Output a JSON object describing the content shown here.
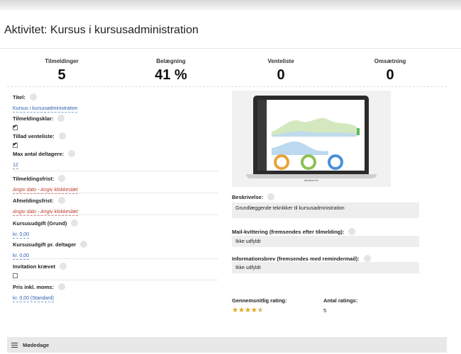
{
  "page": {
    "title": "Aktivitet: Kursus i kursusadministration"
  },
  "stats": [
    {
      "label": "Tilmeldinger",
      "value": "5"
    },
    {
      "label": "Belægning",
      "value": "41 %"
    },
    {
      "label": "Venteliste",
      "value": "0"
    },
    {
      "label": "Omsætning",
      "value": "0"
    }
  ],
  "fields": {
    "titel": {
      "label": "Titel:",
      "value": "Kursus i kursusadministration"
    },
    "tilmeldingsklar": {
      "label": "Tilmeldingsklar:",
      "checked": true
    },
    "tillad_venteliste": {
      "label": "Tillad venteliste:",
      "checked": true
    },
    "max_deltagere": {
      "label": "Max antal deltagere:",
      "value": "12"
    },
    "tilmeldingsfrist": {
      "label": "Tilmeldingsfrist:",
      "value": "Angiv dato - Angiv klokkeslæt"
    },
    "afmeldingsfrist": {
      "label": "Afmeldingsfrist:",
      "value": "Angiv dato - Angiv klokkeslæt"
    },
    "kursusudgift_grund": {
      "label": "Kursusudgift (Grund)",
      "value": "kr. 0,00"
    },
    "kursusudgift_deltager": {
      "label": "Kursusudgift pr. deltager",
      "value": "kr. 0,00"
    },
    "invitation": {
      "label": "Invitation krævet",
      "checked": false
    },
    "pris_moms": {
      "label": "Pris inkl. moms:",
      "value": "kr. 0,00 (Standard)"
    }
  },
  "image": {
    "brand": "MacBook Air"
  },
  "right": {
    "beskrivelse": {
      "label": "Beskrivelse:",
      "value": "Grundlæggende teknikker til kursusadministration"
    },
    "mail_kvittering": {
      "label": "Mail-kvittering (fremsendes efter tilmelding):",
      "value": "Ikke udfyldt"
    },
    "informationsbrev": {
      "label": "Informationsbrev (fremsendes med remindermail):",
      "value": "Ikke udfyldt"
    },
    "rating": {
      "label": "Gennemsnitlig rating:",
      "stars": 4.5
    },
    "antal_ratings": {
      "label": "Antal ratings:",
      "value": "5"
    }
  },
  "footer": {
    "label": "Mødedage",
    "icon": "list-icon"
  },
  "colors": {
    "link": "#2a5db0",
    "warning": "#c0392b",
    "star": "#e2a41a"
  }
}
